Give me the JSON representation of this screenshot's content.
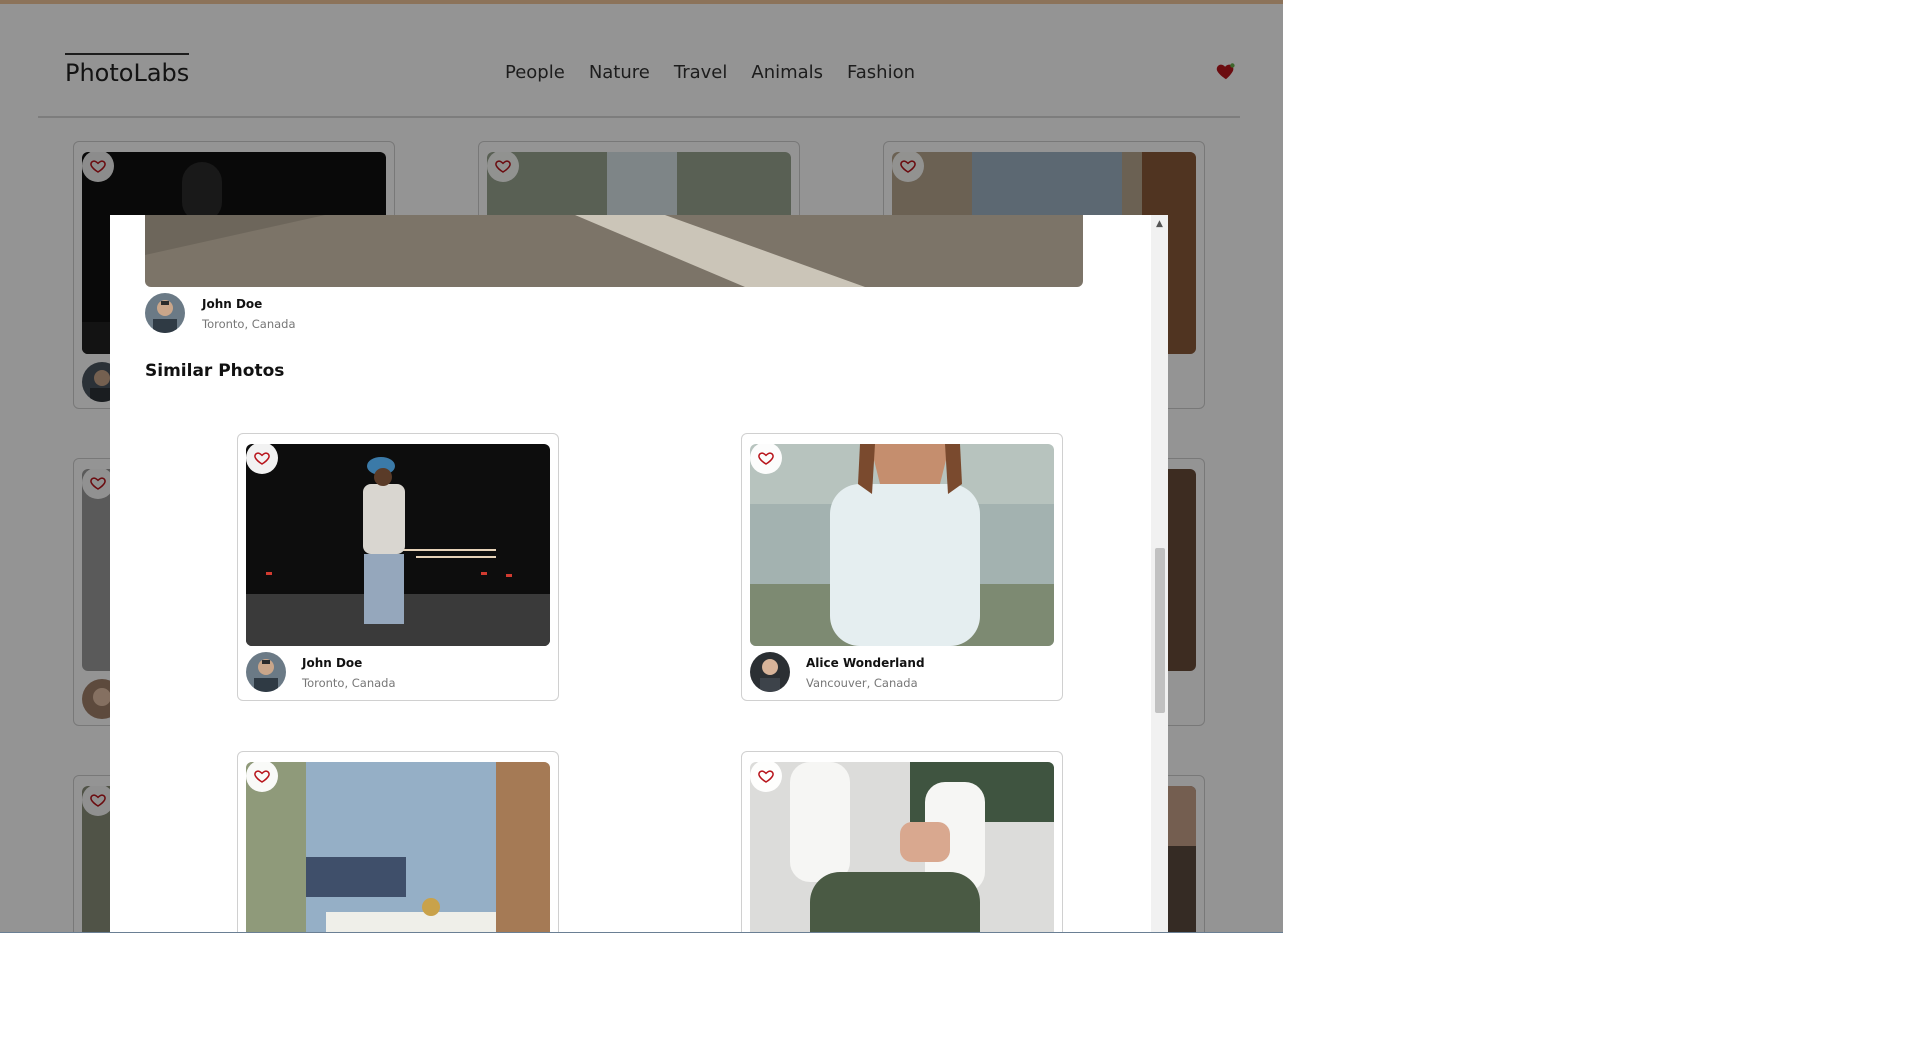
{
  "app": {
    "logo": "PhotoLabs"
  },
  "nav": {
    "topics": [
      "People",
      "Nature",
      "Travel",
      "Animals",
      "Fashion"
    ],
    "favorite_icon": "heart-filled-icon"
  },
  "modal": {
    "main_user": {
      "name": "John Doe",
      "location": "Toronto, Canada"
    },
    "similar_title": "Similar Photos",
    "similar": [
      {
        "name": "John Doe",
        "location": "Toronto, Canada"
      },
      {
        "name": "Alice Wonderland",
        "location": "Vancouver, Canada"
      },
      {
        "name": "",
        "location": ""
      },
      {
        "name": "",
        "location": ""
      }
    ]
  },
  "colors": {
    "accent_heart": "#b8151c",
    "overlay": "rgba(0,0,0,0.42)",
    "top_bar": "#f2c79b"
  }
}
